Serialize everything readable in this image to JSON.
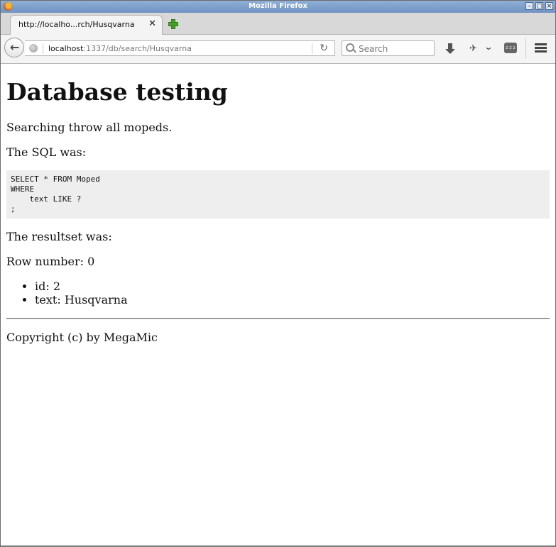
{
  "window": {
    "title": "Mozilla Firefox"
  },
  "tab": {
    "label": "http://localho...rch/Husqvarna",
    "close_glyph": "✕"
  },
  "navbar": {
    "url_host": "localhost",
    "url_rest": ":1337/db/search/Husqvarna",
    "search_placeholder": "Search",
    "zzz_label": "z z z"
  },
  "page": {
    "heading": "Database testing",
    "intro": "Searching throw all mopeds.",
    "sql_label": "The SQL was:",
    "sql_code": "SELECT * FROM Moped\nWHERE\n    text LIKE ?\n;",
    "resultset_label": "The resultset was:",
    "row_label": "Row number: 0",
    "fields": [
      "id: 2",
      "text: Husqvarna"
    ],
    "footer": "Copyright (c) by MegaMic"
  }
}
